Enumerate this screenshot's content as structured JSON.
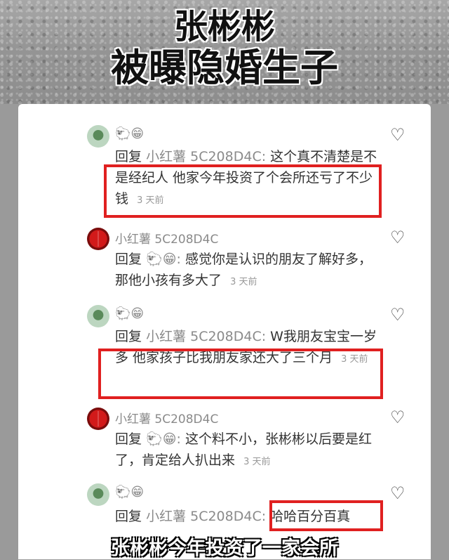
{
  "header": {
    "title_line1": "张彬彬",
    "title_line2": "被曝隐婚生子"
  },
  "comments": [
    {
      "name": "",
      "emoji": "🐑😁",
      "reply_word": "回复",
      "reply_target": "小红薯 5C208D4C:",
      "text": "这个真不清楚是不是经纪人  他家今年投资了个会所还亏了不少钱",
      "time": "3 天前"
    },
    {
      "name": "小红薯 5C208D4C",
      "emoji": "",
      "reply_word": "回复",
      "reply_target": "🐑😁:",
      "text": "感觉你是认识的朋友了解好多，那他小孩有多大了",
      "time": "3 天前"
    },
    {
      "name": "",
      "emoji": "🐑😁",
      "reply_word": "回复",
      "reply_target": "小红薯 5C208D4C:",
      "text": "W我朋友宝宝一岁多 他家孩子比我朋友家还大了三个月",
      "time": "3 天前"
    },
    {
      "name": "小红薯 5C208D4C",
      "emoji": "",
      "reply_word": "回复",
      "reply_target": "🐑😁:",
      "text": "这个料不小，张彬彬以后要是红了，肯定给人扒出来",
      "time": "3 天前"
    },
    {
      "name": "",
      "emoji": "🐑😁",
      "reply_word": "回复",
      "reply_target": "小红薯 5C208D4C:",
      "text": "哈哈百分百真",
      "time": ""
    }
  ],
  "icons": {
    "like": "heart-outline-icon"
  },
  "subtitle": "张彬彬今年投资了一家会所",
  "colors": {
    "highlight": "#e02020"
  }
}
